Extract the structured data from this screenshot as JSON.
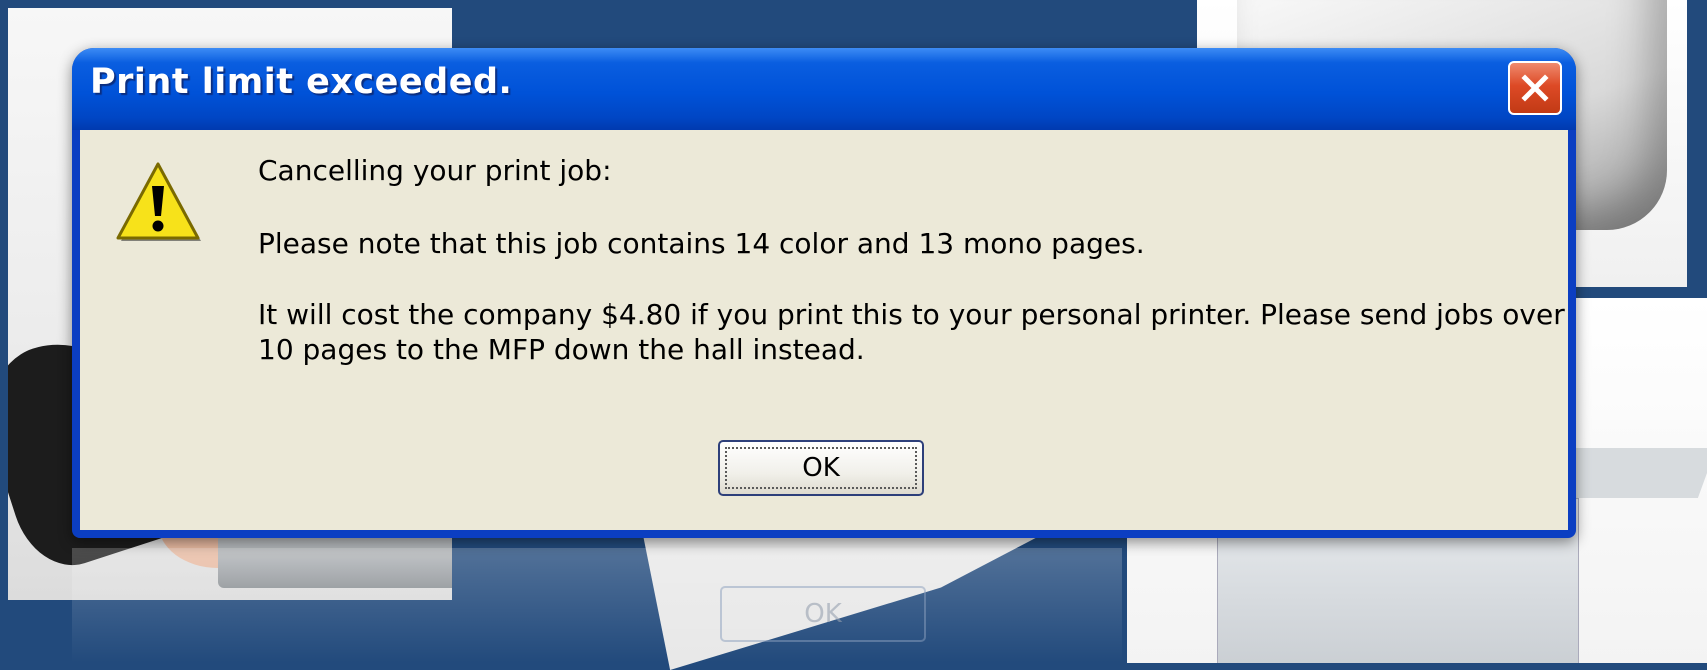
{
  "dialog": {
    "title": "Print limit exceeded.",
    "close_icon": "close-x-icon",
    "icon": "warning-icon",
    "message_lines": [
      "Cancelling your print job:",
      "Please note that this job contains 14 color and 13 mono pages.",
      "It will cost the company $4.80 if you print this to your personal printer.  Please send jobs over",
      "10 pages to the MFP down the hall instead."
    ],
    "ok_label": "OK"
  },
  "background": {
    "reflection_label": "OK"
  },
  "colors": {
    "titlebar": "#0052d8",
    "client": "#ece9d8",
    "close_button": "#dd4a26",
    "desktop": "#224a7c"
  }
}
